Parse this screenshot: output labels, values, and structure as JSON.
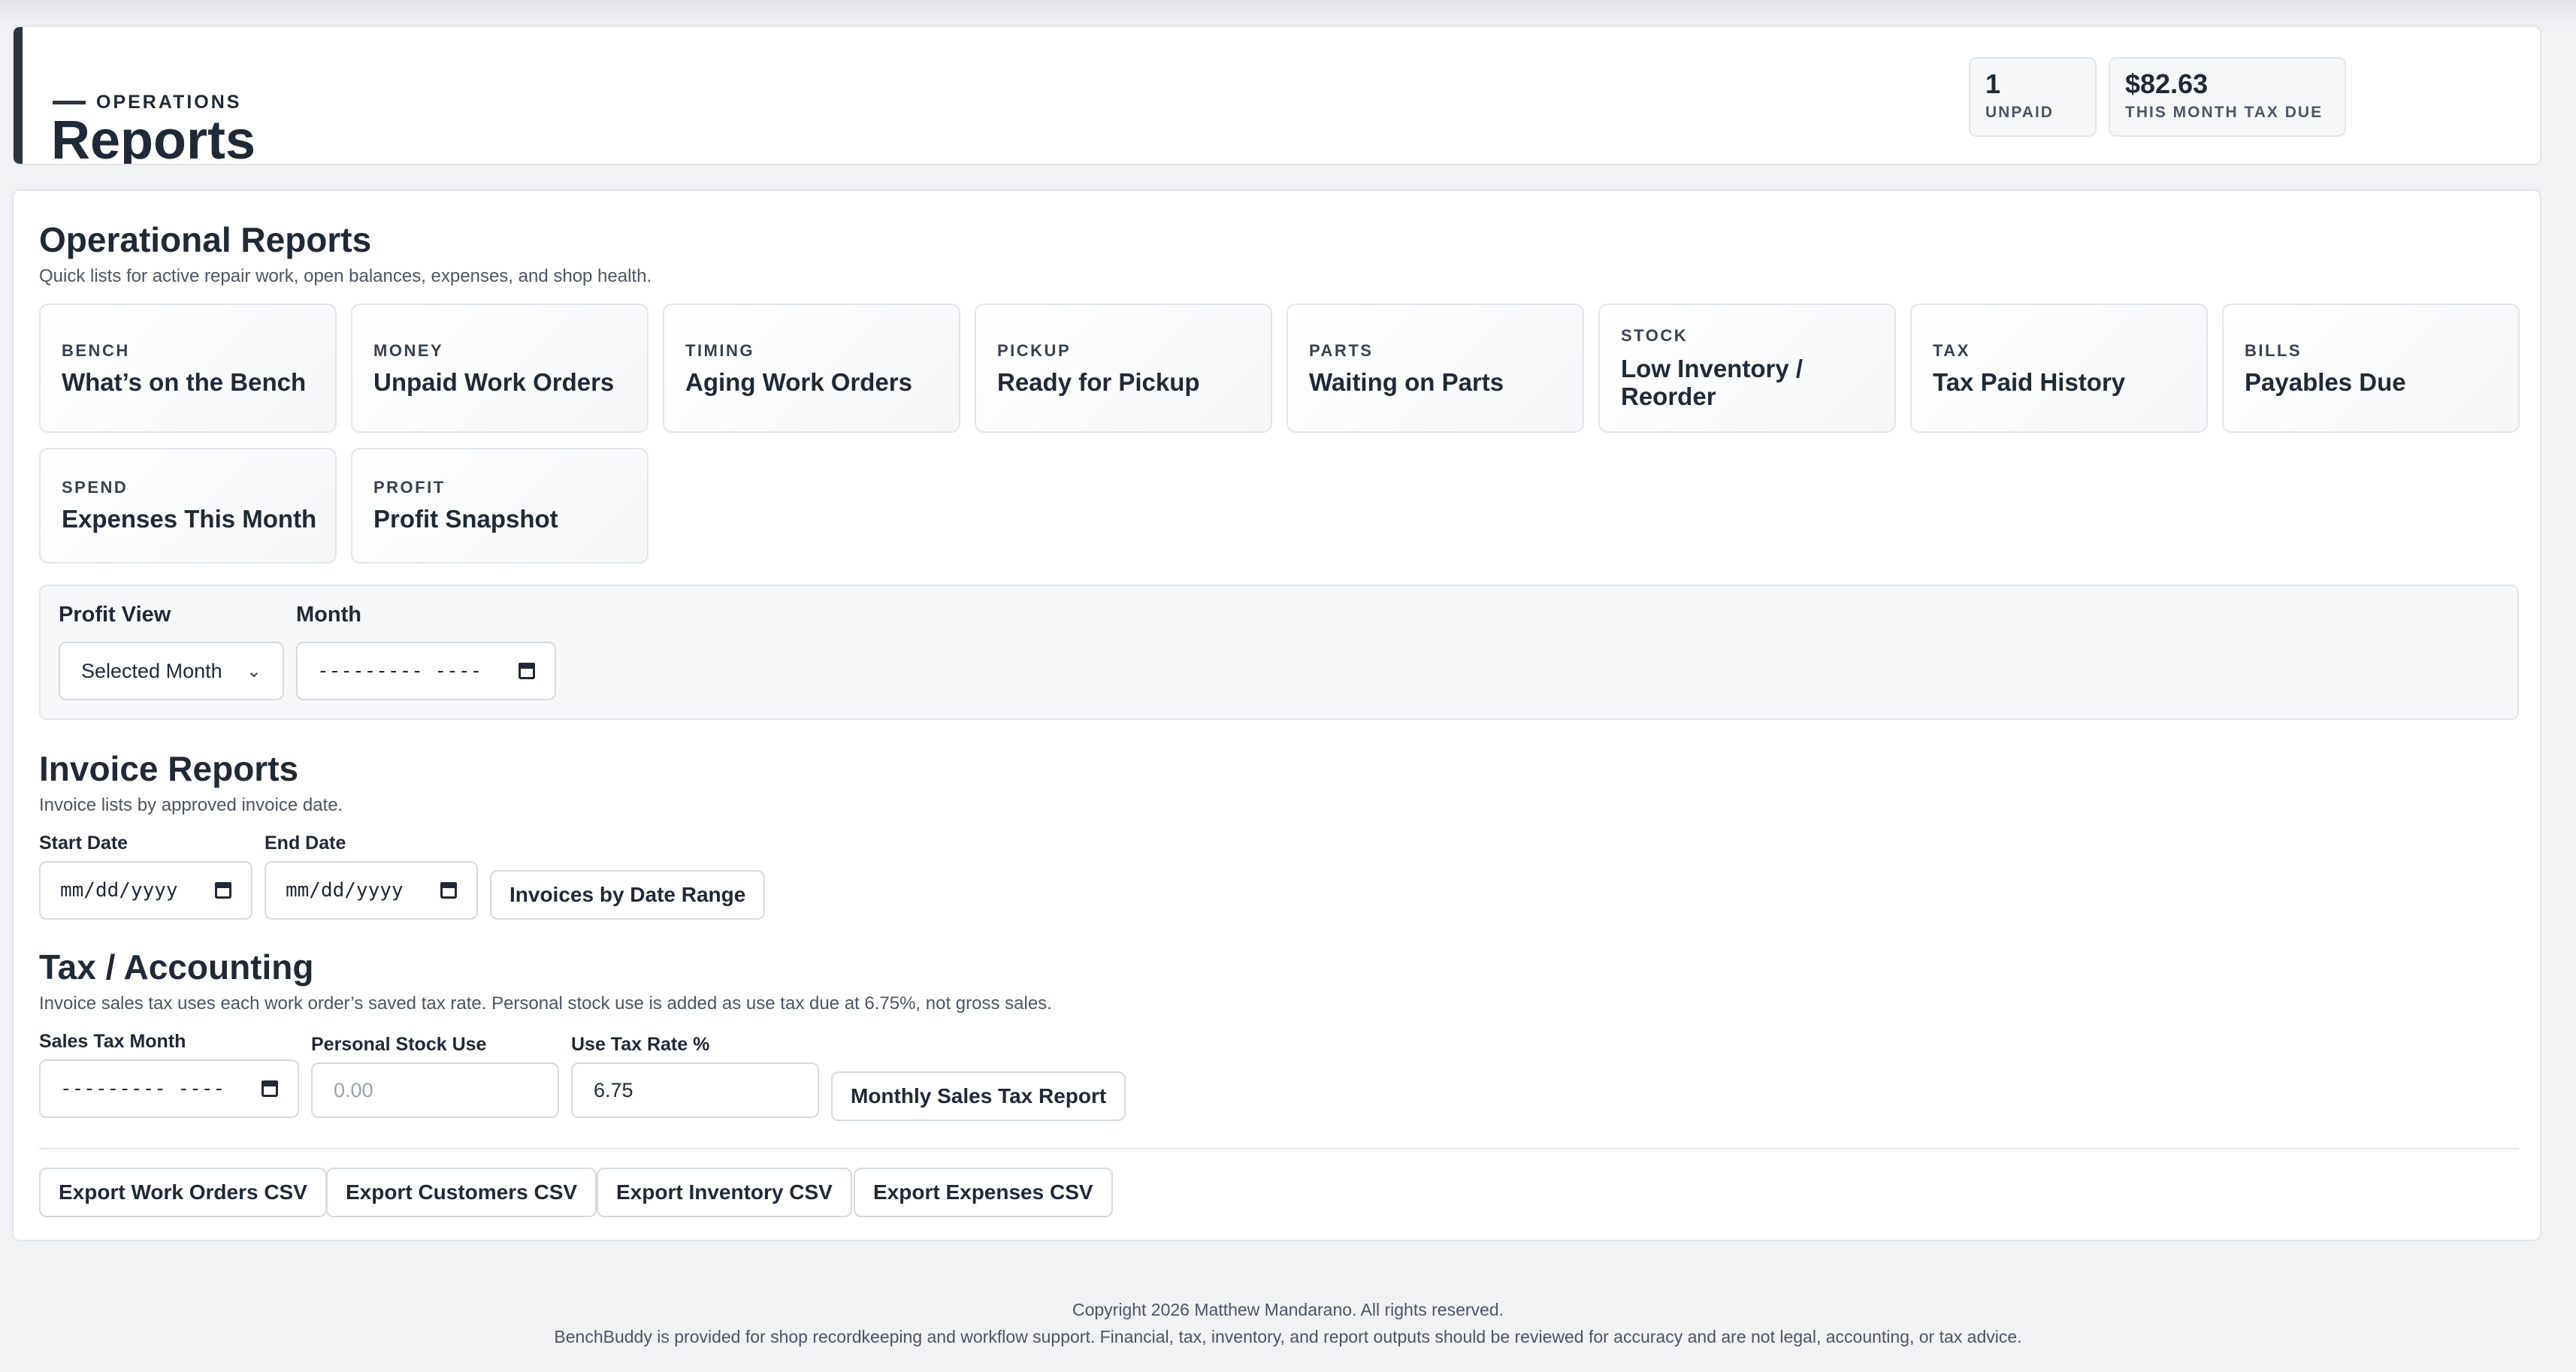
{
  "header": {
    "eyebrow": "OPERATIONS",
    "title": "Reports",
    "stats": [
      {
        "value": "1",
        "label": "UNPAID"
      },
      {
        "value": "$82.63",
        "label": "THIS MONTH TAX DUE"
      }
    ]
  },
  "operational": {
    "title": "Operational Reports",
    "subtitle": "Quick lists for active repair work, open balances, expenses, and shop health.",
    "tiles": [
      {
        "category": "BENCH",
        "name": "What’s on the Bench"
      },
      {
        "category": "MONEY",
        "name": "Unpaid Work Orders"
      },
      {
        "category": "TIMING",
        "name": "Aging Work Orders"
      },
      {
        "category": "PICKUP",
        "name": "Ready for Pickup"
      },
      {
        "category": "PARTS",
        "name": "Waiting on Parts"
      },
      {
        "category": "STOCK",
        "name": "Low Inventory / Reorder"
      },
      {
        "category": "TAX",
        "name": "Tax Paid History"
      },
      {
        "category": "BILLS",
        "name": "Payables Due"
      },
      {
        "category": "SPEND",
        "name": "Expenses This Month"
      },
      {
        "category": "PROFIT",
        "name": "Profit Snapshot"
      }
    ]
  },
  "profit": {
    "view_label": "Profit View",
    "view_value": "Selected Month",
    "month_label": "Month",
    "month_value": "--------- ----"
  },
  "invoice": {
    "title": "Invoice Reports",
    "subtitle": "Invoice lists by approved invoice date.",
    "start_label": "Start Date",
    "start_value": "mm/dd/yyyy",
    "end_label": "End Date",
    "end_value": "mm/dd/yyyy",
    "button": "Invoices by Date Range"
  },
  "tax": {
    "title": "Tax / Accounting",
    "subtitle": "Invoice sales tax uses each work order’s saved tax rate. Personal stock use is added as use tax due at 6.75%, not gross sales.",
    "month_label": "Sales Tax Month",
    "month_value": "--------- ----",
    "stock_label": "Personal Stock Use",
    "stock_placeholder": "0.00",
    "rate_label": "Use Tax Rate %",
    "rate_value": "6.75",
    "button": "Monthly Sales Tax Report"
  },
  "exports": [
    "Export Work Orders CSV",
    "Export Customers CSV",
    "Export Inventory CSV",
    "Export Expenses CSV"
  ],
  "footer": {
    "copyright": "Copyright 2026 Matthew Mandarano. All rights reserved.",
    "disclaimer": "BenchBuddy is provided for shop recordkeeping and workflow support. Financial, tax, inventory, and report outputs should be reviewed for accuracy and are not legal, accounting, or tax advice."
  }
}
